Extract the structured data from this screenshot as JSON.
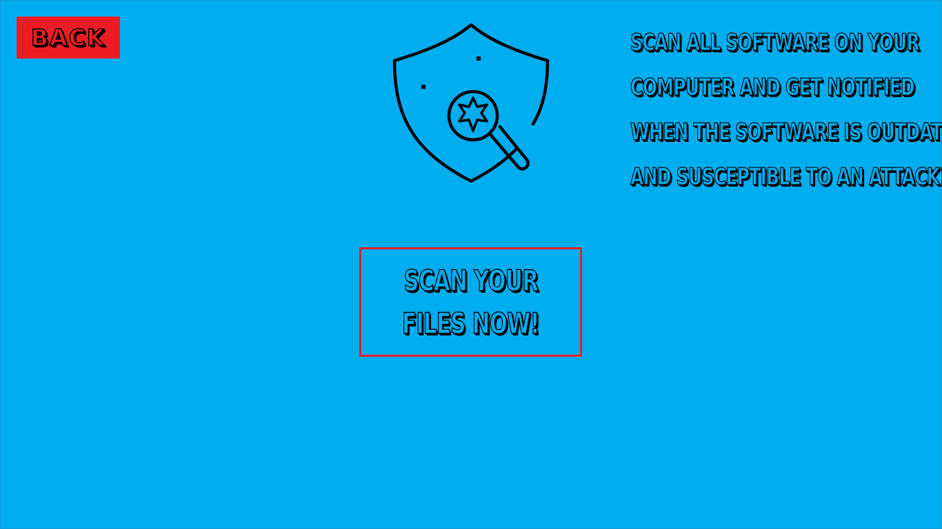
{
  "nav": {
    "back_label": "BACK"
  },
  "hero": {
    "icon": "shield-magnifier-bug-icon"
  },
  "description": {
    "lines": [
      "SCAN ALL SOFTWARE ON YOUR",
      "COMPUTER AND GET NOTIFIED",
      "WHEN THE SOFTWARE IS OUTDATED",
      "AND SUSCEPTIBLE TO AN ATTACK!"
    ]
  },
  "scan_button": {
    "line1": "SCAN YOUR",
    "line2": "FILES NOW!"
  },
  "colors": {
    "background": "#00adef",
    "accent": "#ed1c24",
    "ink": "#000000"
  }
}
